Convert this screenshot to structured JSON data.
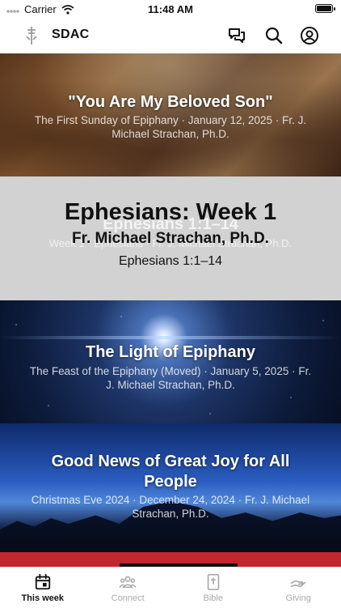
{
  "status_bar": {
    "carrier": "Carrier",
    "time": "11:48 AM"
  },
  "header": {
    "app_title": "SDAC"
  },
  "feed": [
    {
      "title": "\"You Are My Beloved Son\"",
      "subtitle": "The First Sunday of Epiphany · January 12, 2025 · Fr. J. Michael Strachan, Ph.D."
    },
    {
      "series_title": "Ephesians: Week 1",
      "author": "Fr. Michael Strachan, Ph.D.",
      "passage": "Ephesians 1:1–14",
      "overlay_title": "Ephesians 1:1–14",
      "overlay_subtitle": "Week 1 · Ephesians · Fr. J. Michael Strachan, Ph.D."
    },
    {
      "title": "The Light of Epiphany",
      "subtitle": "The Feast of the Epiphany (Moved) · January 5, 2025 · Fr. J. Michael Strachan, Ph.D."
    },
    {
      "title": "Good News of Great Joy for All People",
      "subtitle": "Christmas Eve 2024 · December 24, 2024 · Fr. J. Michael Strachan, Ph.D."
    }
  ],
  "tabbar": [
    {
      "label": "This week",
      "icon": "calendar-icon",
      "active": true
    },
    {
      "label": "Connect",
      "icon": "people-icon",
      "active": false
    },
    {
      "label": "Bible",
      "icon": "bible-icon",
      "active": false
    },
    {
      "label": "Giving",
      "icon": "giving-hand-icon",
      "active": false
    }
  ]
}
